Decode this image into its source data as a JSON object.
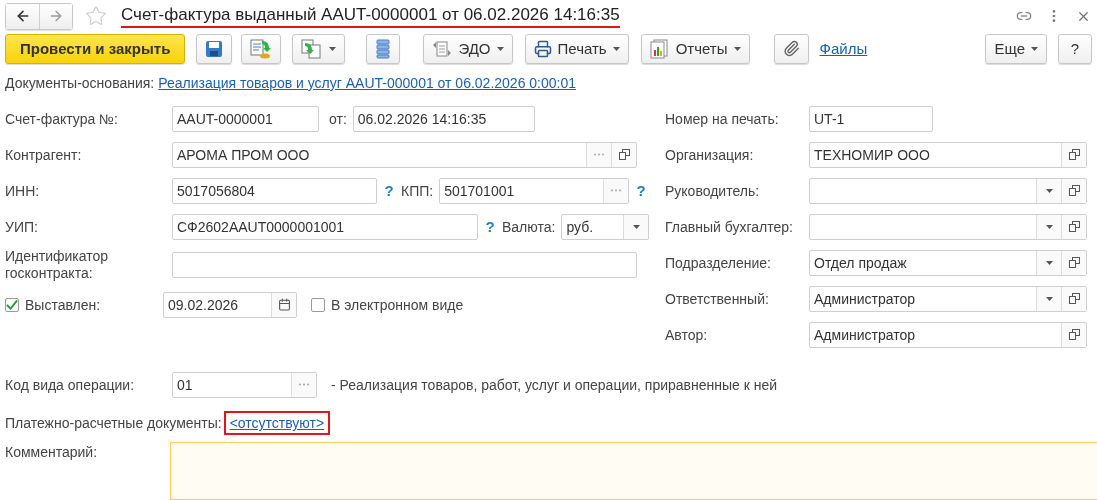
{
  "window": {
    "title": "Счет-фактура выданный AAUT-0000001 от 06.02.2026 14:16:35",
    "title_highlighted": true,
    "favorite": false
  },
  "toolbar": [
    {
      "kind": "primary",
      "label": "Провести и закрыть"
    },
    {
      "kind": "save"
    },
    {
      "kind": "post"
    },
    {
      "kind": "derive"
    },
    {
      "kind": "structure"
    },
    {
      "kind": "edo",
      "label": "ЭДО"
    },
    {
      "kind": "print",
      "label": "Печать"
    },
    {
      "kind": "reports",
      "label": "Отчеты"
    },
    {
      "kind": "attach"
    },
    {
      "kind": "files",
      "label": "Файлы"
    },
    {
      "kind": "more",
      "label": "Еще"
    },
    {
      "kind": "help",
      "label": "?"
    }
  ],
  "basis": {
    "label": "Документы-основания:",
    "link": "Реализация товаров и услуг AAUT-000001 от 06.02.2026 0:00:01"
  },
  "left": {
    "invoice": {
      "label": "Счет-фактура №:",
      "number": "AAUT-0000001",
      "date_label": "от:",
      "date": "06.02.2026 14:16:35"
    },
    "counterparty": {
      "label": "Контрагент:",
      "value": "АРОМА ПРОМ ООО"
    },
    "inn": {
      "label": "ИНН:",
      "value": "5017056804",
      "help": "?"
    },
    "kpp": {
      "label": "КПП:",
      "value": "501701001",
      "help": "?"
    },
    "uip": {
      "label": "УИП:",
      "value": "СФ2602AAUT0000001001",
      "help": "?"
    },
    "currency": {
      "label": "Валюта:",
      "value": "руб."
    },
    "contract": {
      "label": "Идентификатор госконтракта:"
    },
    "issued": {
      "label": "Выставлен:",
      "checked": true,
      "date": "09.02.2026"
    },
    "electronic": {
      "label": "В электронном виде",
      "checked": false
    }
  },
  "right": [
    {
      "kind": "plain",
      "label": "Номер на печать:",
      "value": "UT-1"
    },
    {
      "kind": "ref",
      "label": "Организация:",
      "value": "ТЕХНОМИР ООО"
    },
    {
      "kind": "select",
      "label": "Руководитель:"
    },
    {
      "kind": "select",
      "label": "Главный бухгалтер:"
    },
    {
      "kind": "select",
      "label": "Подразделение:",
      "value": "Отдел продаж"
    },
    {
      "kind": "select",
      "label": "Ответственный:",
      "value": "Администратор"
    },
    {
      "kind": "ref",
      "label": "Автор:",
      "value": "Администратор"
    }
  ],
  "operation": {
    "label": "Код вида операции:",
    "value": "01",
    "description": "- Реализация товаров, работ, услуг и операции, приравненные к ней"
  },
  "payments": {
    "label": "Платежно-расчетные документы:",
    "link": "<отсутствуют>",
    "highlighted": true
  },
  "comment": {
    "label": "Комментарий:"
  }
}
